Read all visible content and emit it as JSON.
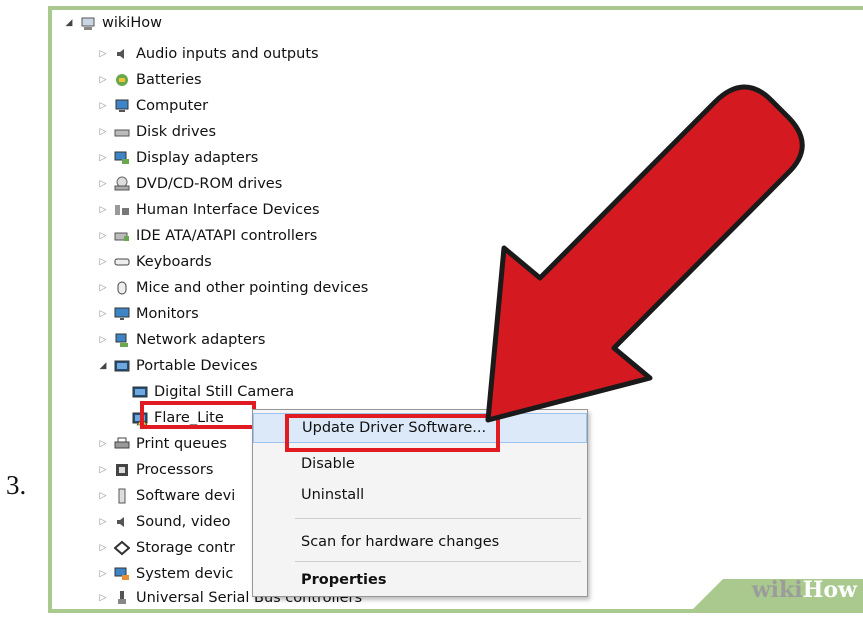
{
  "step_number": "3.",
  "tree": {
    "root": "wikiHow",
    "items": [
      {
        "label": "Audio inputs and outputs",
        "icon": "speaker-icon"
      },
      {
        "label": "Batteries",
        "icon": "battery-icon"
      },
      {
        "label": "Computer",
        "icon": "computer-icon"
      },
      {
        "label": "Disk drives",
        "icon": "disk-drive-icon"
      },
      {
        "label": "Display adapters",
        "icon": "display-adapter-icon"
      },
      {
        "label": "DVD/CD-ROM drives",
        "icon": "dvd-drive-icon"
      },
      {
        "label": "Human Interface Devices",
        "icon": "hid-icon"
      },
      {
        "label": "IDE ATA/ATAPI controllers",
        "icon": "ide-controller-icon"
      },
      {
        "label": "Keyboards",
        "icon": "keyboard-icon"
      },
      {
        "label": "Mice and other pointing devices",
        "icon": "mouse-icon"
      },
      {
        "label": "Monitors",
        "icon": "monitor-icon"
      },
      {
        "label": "Network adapters",
        "icon": "network-adapter-icon"
      },
      {
        "label": "Portable Devices",
        "icon": "portable-device-icon"
      },
      {
        "label": "Digital Still Camera",
        "icon": "camera-device-icon"
      },
      {
        "label": "Flare_Lite",
        "icon": "warning-device-icon"
      },
      {
        "label": "Print queues",
        "icon": "printer-icon"
      },
      {
        "label": "Processors",
        "icon": "processor-icon"
      },
      {
        "label": "Software devi",
        "icon": "software-device-icon"
      },
      {
        "label": "Sound, video",
        "icon": "sound-icon"
      },
      {
        "label": "Storage contr",
        "icon": "storage-icon"
      },
      {
        "label": "System devic",
        "icon": "system-device-icon"
      },
      {
        "label": "Universal Serial Bus controllers",
        "icon": "usb-icon"
      }
    ]
  },
  "context_menu": {
    "update": "Update Driver Software...",
    "disable": "Disable",
    "uninstall": "Uninstall",
    "scan": "Scan for hardware changes",
    "properties": "Properties"
  },
  "watermark": {
    "part1": "wiki",
    "part2": "How"
  },
  "colors": {
    "highlight_red": "#e01b22",
    "arrow_red": "#d41920",
    "frame_green": "#a9c98e"
  }
}
